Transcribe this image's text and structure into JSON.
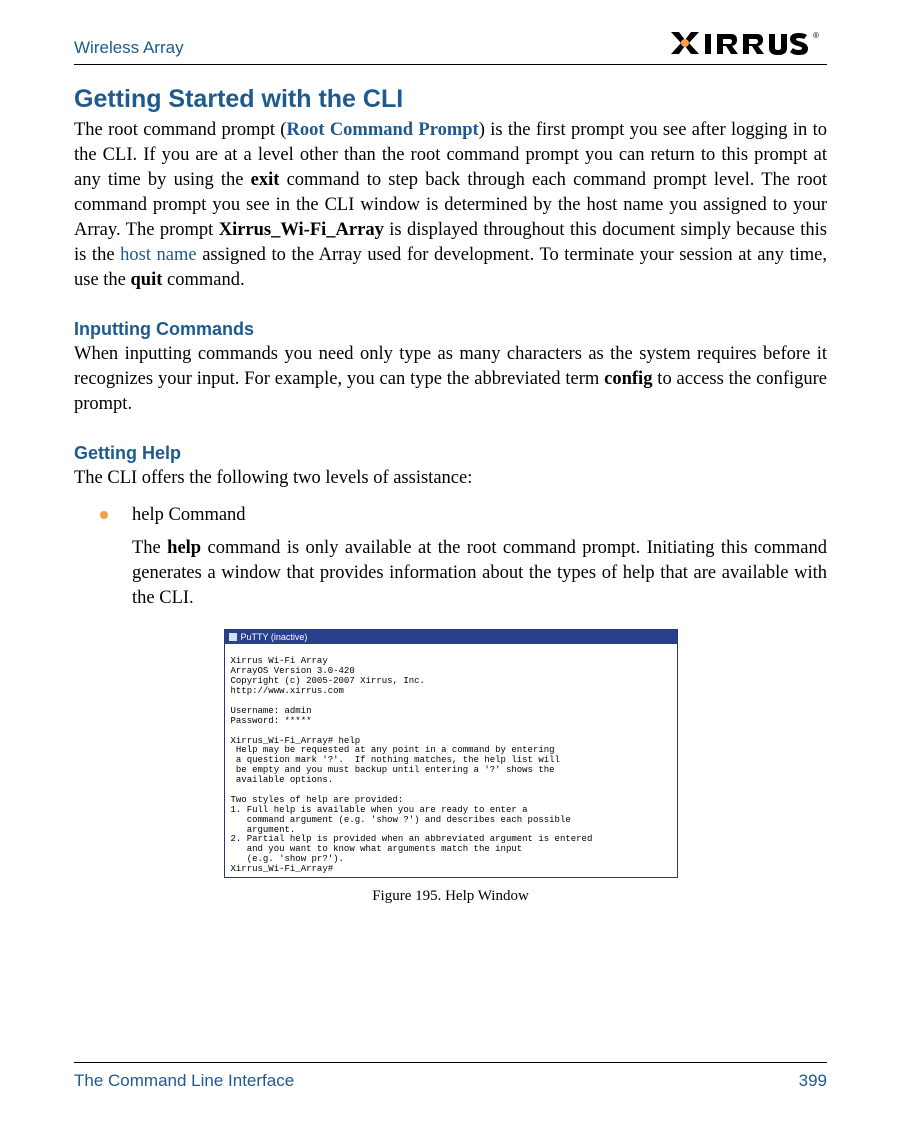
{
  "header": {
    "left": "Wireless Array",
    "logo_text": "XIRRUS",
    "logo_mark": "®"
  },
  "sections": {
    "h1": "Getting Started with the CLI",
    "p1_a": "The root command prompt (",
    "p1_link": "Root Command Prompt",
    "p1_b": ") is the first prompt you see after logging in to the CLI. If you are at a level other than the root command prompt you can return to this prompt at any time by using the ",
    "p1_boldA": "exit",
    "p1_c": " command to step back through each command prompt level. The root command prompt you see in the CLI window is determined by the host name you assigned to your Array. The prompt ",
    "p1_boldB": "Xirrus_Wi-Fi_Array",
    "p1_d": " is displayed throughout this document simply because this is the ",
    "p1_link2": "host name",
    "p1_e": " assigned to the Array used for development. To terminate your session at any time, use the ",
    "p1_boldC": "quit",
    "p1_f": " command.",
    "h2a": "Inputting Commands",
    "p2_a": "When inputting commands you need only type as many characters as the system requires before it recognizes your input. For example, you can type the abbreviated term ",
    "p2_bold": "config",
    "p2_b": " to access the configure prompt.",
    "h2b": "Getting Help",
    "p3": "The CLI offers the following two levels of assistance:",
    "bullet_title": "help Command",
    "bullet_body_a": "The ",
    "bullet_body_bold": "help",
    "bullet_body_b": " command is only available at the root command prompt. Initiating this command generates a window that provides information about the types of help that are available with the CLI."
  },
  "terminal": {
    "title": "PuTTY (inactive)",
    "lines": "\nXirrus Wi-Fi Array\nArrayOS Version 3.0-420\nCopyright (c) 2005-2007 Xirrus, Inc.\nhttp://www.xirrus.com\n\nUsername: admin\nPassword: *****\n\nXirrus_Wi-Fi_Array# help\n Help may be requested at any point in a command by entering\n a question mark '?'.  If nothing matches, the help list will\n be empty and you must backup until entering a '?' shows the\n available options.\n\nTwo styles of help are provided:\n1. Full help is available when you are ready to enter a\n   command argument (e.g. 'show ?') and describes each possible\n   argument.\n2. Partial help is provided when an abbreviated argument is entered\n   and you want to know what arguments match the input\n   (e.g. 'show pr?').\nXirrus_Wi-Fi_Array#"
  },
  "figure_caption": "Figure 195. Help Window",
  "footer": {
    "left": "The Command Line Interface",
    "right": "399"
  }
}
